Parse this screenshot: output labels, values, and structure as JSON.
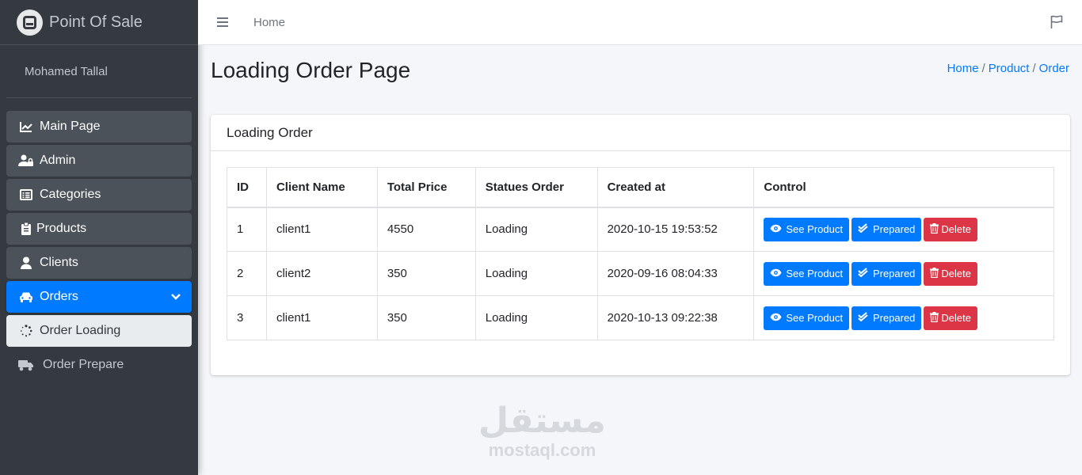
{
  "brand": {
    "title": "Point Of Sale"
  },
  "user": {
    "name": "Mohamed Tallal"
  },
  "sidebar": {
    "items": [
      {
        "label": "Main Page",
        "icon": "chart-line-icon"
      },
      {
        "label": "Admin",
        "icon": "user-lock-icon"
      },
      {
        "label": "Categories",
        "icon": "list-alt-icon"
      },
      {
        "label": "Products",
        "icon": "clipboard-icon"
      },
      {
        "label": "Clients",
        "icon": "user-icon"
      },
      {
        "label": "Orders",
        "icon": "car-icon",
        "active": true
      }
    ],
    "sub_items": [
      {
        "label": "Order Loading",
        "icon": "spinner-icon",
        "active": true
      },
      {
        "label": "Order Prepare",
        "icon": "truck-icon"
      }
    ]
  },
  "navbar": {
    "home": "Home"
  },
  "page": {
    "title": "Loading Order Page",
    "breadcrumb": [
      "Home",
      "Product",
      "Order"
    ]
  },
  "card": {
    "title": "Loading Order"
  },
  "table": {
    "headers": [
      "ID",
      "Client Name",
      "Total Price",
      "Statues Order",
      "Created at",
      "Control"
    ],
    "rows": [
      {
        "id": "1",
        "client": "client1",
        "total": "4550",
        "status": "Loading",
        "created": "2020-10-15 19:53:52"
      },
      {
        "id": "2",
        "client": "client2",
        "total": "350",
        "status": "Loading",
        "created": "2020-09-16 08:04:33"
      },
      {
        "id": "3",
        "client": "client1",
        "total": "350",
        "status": "Loading",
        "created": "2020-10-13 09:22:38"
      }
    ],
    "buttons": {
      "see": "See Product",
      "prepared": "Prepared",
      "delete": "Delete"
    }
  },
  "watermark": {
    "arabic": "مستقل",
    "latin": "mostaql.com"
  },
  "colors": {
    "sidebar": "#343a40",
    "primary": "#007bff",
    "danger": "#dc3545",
    "background": "#f4f6f9"
  }
}
